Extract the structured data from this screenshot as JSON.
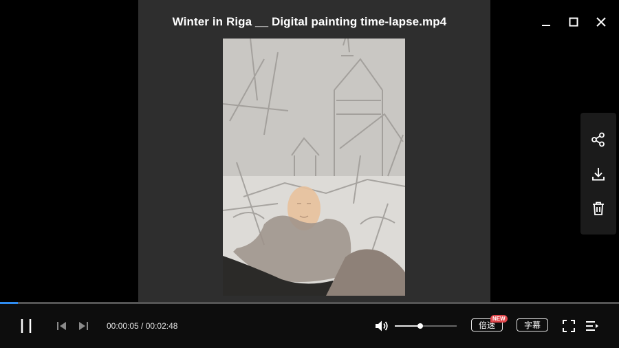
{
  "window": {
    "title": "Winter in Riga __ Digital painting time-lapse.mp4"
  },
  "playback": {
    "current_time": "00:00:05",
    "separator": " / ",
    "total_time": "00:02:48",
    "progress_fraction": 0.029,
    "volume_fraction": 0.41,
    "state": "playing"
  },
  "side_panel": {
    "icons": [
      "share-icon",
      "download-icon",
      "trash-icon"
    ]
  },
  "controls": {
    "speed_label": "倍速",
    "speed_badge": "NEW",
    "subtitle_label": "字幕",
    "icons": [
      "pause-icon",
      "previous-icon",
      "next-icon",
      "volume-icon",
      "fullscreen-icon",
      "playlist-icon"
    ]
  },
  "colors": {
    "accent": "#2f8cf0",
    "badge": "#e0454a",
    "background": "#000000",
    "video_stage": "#2e2e2e"
  }
}
